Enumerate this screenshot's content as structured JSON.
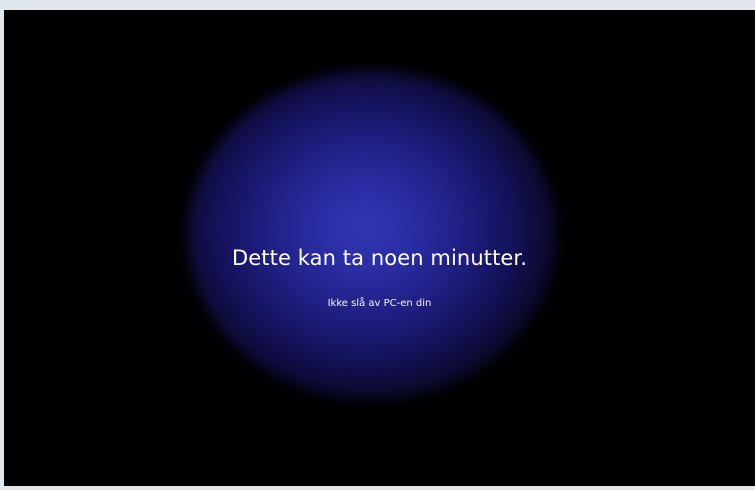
{
  "screen": {
    "title": "Dette kan ta noen minutter.",
    "subtitle": "Ikke slå av PC-en din"
  }
}
